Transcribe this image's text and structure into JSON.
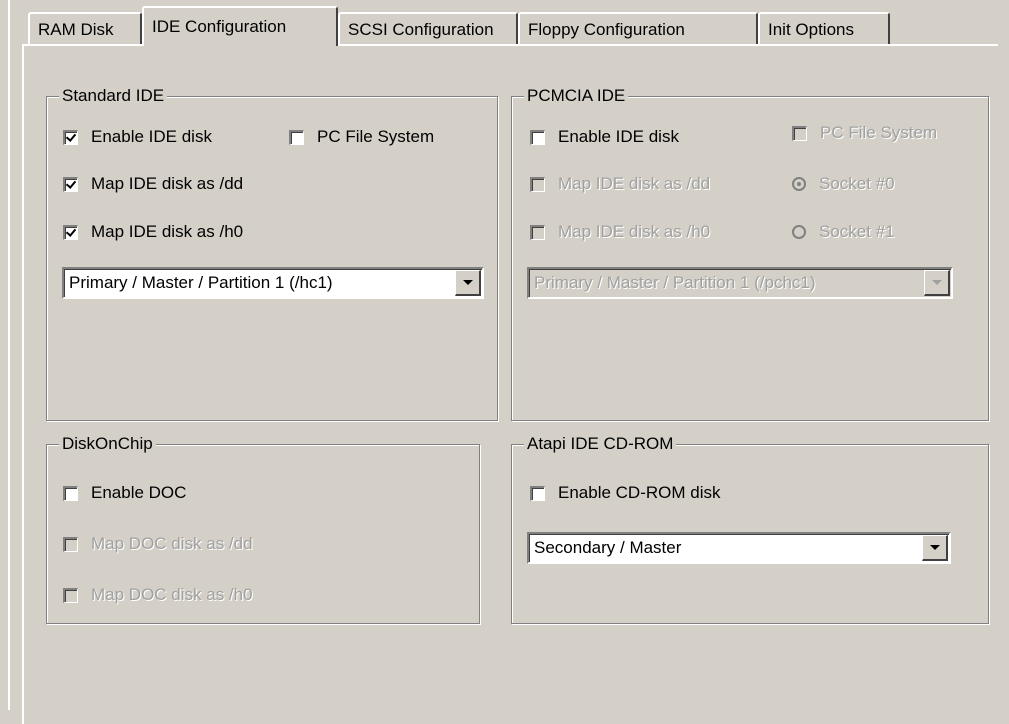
{
  "tabs": [
    {
      "label": "RAM Disk"
    },
    {
      "label": "IDE Configuration"
    },
    {
      "label": "SCSI Configuration"
    },
    {
      "label": "Floppy Configuration"
    },
    {
      "label": "Init Options"
    }
  ],
  "standard_ide": {
    "title": "Standard IDE",
    "enable_ide": {
      "label": "Enable IDE disk",
      "checked": true
    },
    "pc_fs": {
      "label": "PC File System",
      "checked": false
    },
    "map_dd": {
      "label": "Map IDE disk as /dd",
      "checked": true
    },
    "map_h0": {
      "label": "Map IDE disk as /h0",
      "checked": true
    },
    "select": {
      "value": "Primary / Master / Partition 1 (/hc1)"
    }
  },
  "pcmcia_ide": {
    "title": "PCMCIA IDE",
    "enable_ide": {
      "label": "Enable IDE disk",
      "checked": false
    },
    "pc_fs": {
      "label": "PC File System",
      "checked": false,
      "disabled": true
    },
    "map_dd": {
      "label": "Map IDE disk as /dd",
      "disabled": true
    },
    "map_h0": {
      "label": "Map IDE disk as /h0",
      "disabled": true
    },
    "socket0": {
      "label": "Socket #0",
      "selected": true
    },
    "socket1": {
      "label": "Socket #1",
      "selected": false
    },
    "select": {
      "value": "Primary / Master / Partition 1 (/pchc1)"
    }
  },
  "diskonchip": {
    "title": "DiskOnChip",
    "enable_doc": {
      "label": "Enable DOC",
      "checked": false
    },
    "map_dd": {
      "label": "Map DOC disk as /dd",
      "disabled": true
    },
    "map_h0": {
      "label": "Map DOC disk as /h0",
      "disabled": true
    }
  },
  "atapi": {
    "title": "Atapi IDE CD-ROM",
    "enable_cdrom": {
      "label": "Enable CD-ROM disk",
      "checked": false
    },
    "select": {
      "value": "Secondary / Master"
    }
  },
  "colors": {
    "face": "#d4d0c8",
    "shadow": "#808080",
    "highlight": "#ffffff",
    "disabled_text": "#a0a0a0"
  }
}
